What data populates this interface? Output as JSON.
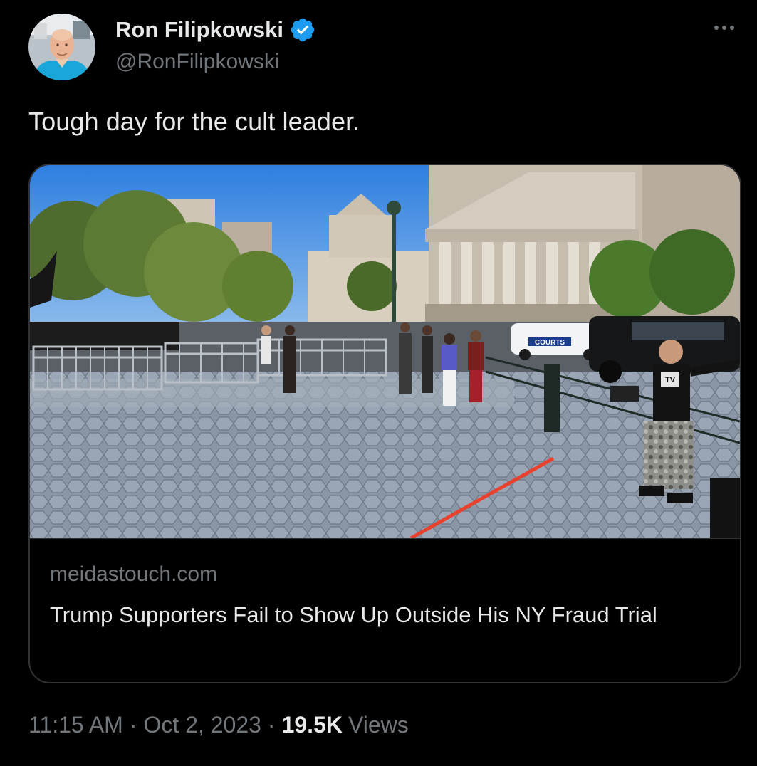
{
  "author": {
    "display_name": "Ron Filipkowski",
    "handle": "@RonFilipkowski",
    "verified": true
  },
  "tweet": {
    "text": "Tough day for the cult leader."
  },
  "card": {
    "domain": "meidastouch.com",
    "title": "Trump Supporters Fail to Show Up Outside His NY Fraud Trial",
    "image_signage": {
      "police_car": "COURTS",
      "badge": "TV"
    }
  },
  "meta": {
    "time": "11:15 AM",
    "date": "Oct 2, 2023",
    "separator": "·",
    "views_count": "19.5K",
    "views_label": "Views"
  },
  "colors": {
    "background": "#000000",
    "primary_text": "#e7e9ea",
    "secondary_text": "#71767b",
    "border": "#2f3336",
    "verified_blue": "#1d9bf0"
  }
}
